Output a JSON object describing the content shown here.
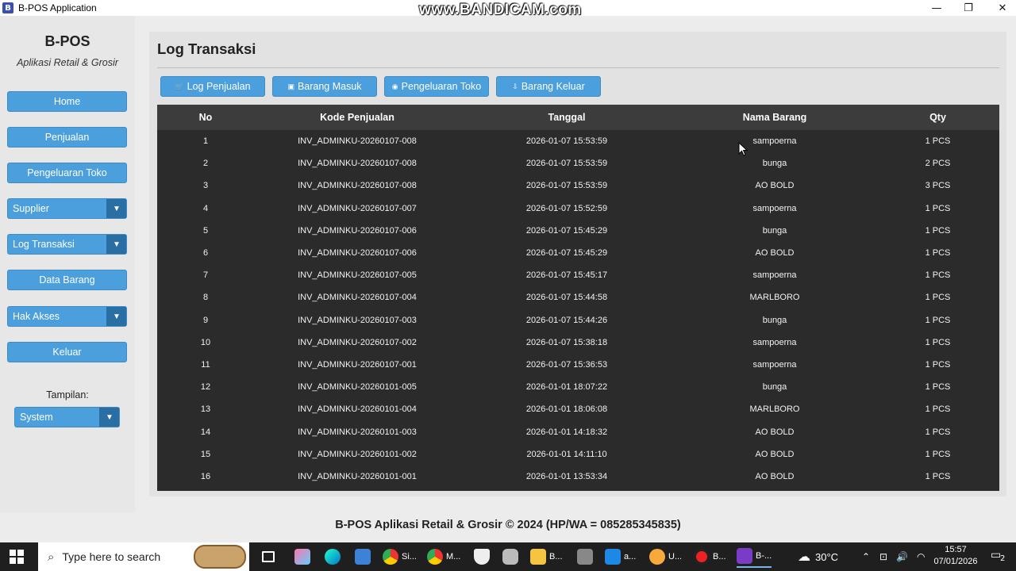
{
  "window": {
    "title": "B-POS Application",
    "watermark": "www.BANDICAM.com",
    "controls": {
      "minimize": "—",
      "maximize": "❐",
      "close": "✕"
    }
  },
  "sidebar": {
    "brand": "B-POS",
    "tagline": "Aplikasi Retail & Grosir",
    "home": "Home",
    "penjualan": "Penjualan",
    "pengeluaran": "Pengeluaran Toko",
    "supplier": "Supplier",
    "log_transaksi": "Log Transaksi",
    "data_barang": "Data Barang",
    "hak_akses": "Hak Akses",
    "keluar": "Keluar",
    "tampilan_label": "Tampilan:",
    "tampilan_value": "System"
  },
  "main": {
    "title": "Log Transaksi",
    "tabs": {
      "log_penjualan": "Log Penjualan",
      "barang_masuk": "Barang Masuk",
      "pengeluaran_toko": "Pengeluaran Toko",
      "barang_keluar": "Barang Keluar"
    }
  },
  "table": {
    "columns": [
      "No",
      "Kode Penjualan",
      "Tanggal",
      "Nama Barang",
      "Qty"
    ],
    "rows": [
      [
        "1",
        "INV_ADMINKU-20260107-008",
        "2026-01-07 15:53:59",
        "sampoerna",
        "1 PCS"
      ],
      [
        "2",
        "INV_ADMINKU-20260107-008",
        "2026-01-07 15:53:59",
        "bunga",
        "2 PCS"
      ],
      [
        "3",
        "INV_ADMINKU-20260107-008",
        "2026-01-07 15:53:59",
        "AO BOLD",
        "3 PCS"
      ],
      [
        "4",
        "INV_ADMINKU-20260107-007",
        "2026-01-07 15:52:59",
        "sampoerna",
        "1 PCS"
      ],
      [
        "5",
        "INV_ADMINKU-20260107-006",
        "2026-01-07 15:45:29",
        "bunga",
        "1 PCS"
      ],
      [
        "6",
        "INV_ADMINKU-20260107-006",
        "2026-01-07 15:45:29",
        "AO BOLD",
        "1 PCS"
      ],
      [
        "7",
        "INV_ADMINKU-20260107-005",
        "2026-01-07 15:45:17",
        "sampoerna",
        "1 PCS"
      ],
      [
        "8",
        "INV_ADMINKU-20260107-004",
        "2026-01-07 15:44:58",
        "MARLBORO",
        "1 PCS"
      ],
      [
        "9",
        "INV_ADMINKU-20260107-003",
        "2026-01-07 15:44:26",
        "bunga",
        "1 PCS"
      ],
      [
        "10",
        "INV_ADMINKU-20260107-002",
        "2026-01-07 15:38:18",
        "sampoerna",
        "1 PCS"
      ],
      [
        "11",
        "INV_ADMINKU-20260107-001",
        "2026-01-07 15:36:53",
        "sampoerna",
        "1 PCS"
      ],
      [
        "12",
        "INV_ADMINKU-20260101-005",
        "2026-01-01 18:07:22",
        "bunga",
        "1 PCS"
      ],
      [
        "13",
        "INV_ADMINKU-20260101-004",
        "2026-01-01 18:06:08",
        "MARLBORO",
        "1 PCS"
      ],
      [
        "14",
        "INV_ADMINKU-20260101-003",
        "2026-01-01 14:18:32",
        "AO BOLD",
        "1 PCS"
      ],
      [
        "15",
        "INV_ADMINKU-20260101-002",
        "2026-01-01 14:11:10",
        "AO BOLD",
        "1 PCS"
      ],
      [
        "16",
        "INV_ADMINKU-20260101-001",
        "2026-01-01 13:53:34",
        "AO BOLD",
        "1 PCS"
      ]
    ]
  },
  "footer": "B-POS Aplikasi Retail & Grosir © 2024  (HP/WA = 085285345835)",
  "taskbar": {
    "search_placeholder": "Type here to search",
    "apps": [
      {
        "label": "Si...",
        "icon": "chrome-icon"
      },
      {
        "label": "M...",
        "icon": "chrome-icon"
      },
      {
        "label": "B...",
        "icon": "folder-icon"
      },
      {
        "label": "a...",
        "icon": "vscode-icon"
      },
      {
        "label": "U...",
        "icon": "app-icon"
      },
      {
        "label": "B...",
        "icon": "record-icon"
      },
      {
        "label": "B-...",
        "icon": "bpos-icon"
      }
    ],
    "temperature": "30°C",
    "time": "15:57",
    "date": "07/01/2026",
    "notifications": "2"
  },
  "colors": {
    "button": "#4a9fdc",
    "table_bg": "#2b2b2b",
    "table_header": "#3c3c3c",
    "taskbar": "#1f1f1f"
  }
}
